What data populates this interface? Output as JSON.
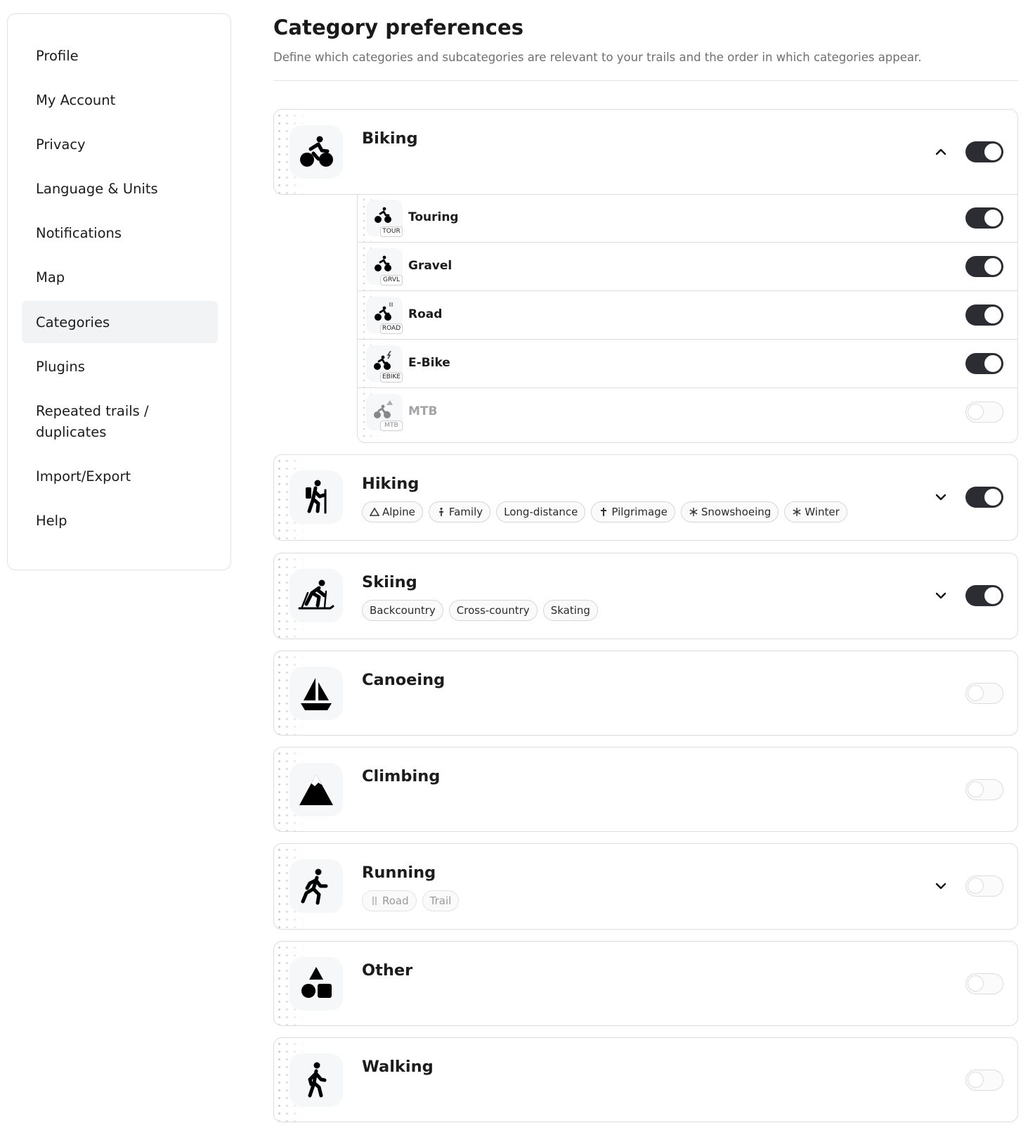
{
  "sidebar": {
    "items": [
      {
        "label": "Profile"
      },
      {
        "label": "My Account"
      },
      {
        "label": "Privacy"
      },
      {
        "label": "Language & Units"
      },
      {
        "label": "Notifications"
      },
      {
        "label": "Map"
      },
      {
        "label": "Categories",
        "active": true
      },
      {
        "label": "Plugins"
      },
      {
        "label": "Repeated trails / duplicates"
      },
      {
        "label": "Import/Export"
      },
      {
        "label": "Help"
      }
    ]
  },
  "header": {
    "title": "Category preferences",
    "subtitle": "Define which categories and subcategories are relevant to your trails and the order in which categories appear."
  },
  "categories": [
    {
      "name": "Biking",
      "icon": "bike-icon",
      "enabled": true,
      "expanded": true,
      "subcategories": [
        {
          "name": "Touring",
          "badge": "TOUR",
          "enabled": true
        },
        {
          "name": "Gravel",
          "badge": "GRVL",
          "enabled": true
        },
        {
          "name": "Road",
          "badge": "ROAD",
          "enabled": true
        },
        {
          "name": "E-Bike",
          "badge": "EBIKE",
          "enabled": true
        },
        {
          "name": "MTB",
          "badge": "MTB",
          "enabled": false
        }
      ]
    },
    {
      "name": "Hiking",
      "icon": "hiker-icon",
      "enabled": true,
      "expanded": false,
      "chips": [
        {
          "label": "Alpine",
          "icon": "mountain-icon"
        },
        {
          "label": "Family",
          "icon": "person-icon"
        },
        {
          "label": "Long-distance",
          "icon": ""
        },
        {
          "label": "Pilgrimage",
          "icon": "cross-icon"
        },
        {
          "label": "Snowshoeing",
          "icon": "snowflake-icon"
        },
        {
          "label": "Winter",
          "icon": "snowflake-icon"
        }
      ]
    },
    {
      "name": "Skiing",
      "icon": "skier-icon",
      "enabled": true,
      "expanded": false,
      "chips": [
        {
          "label": "Backcountry",
          "icon": ""
        },
        {
          "label": "Cross-country",
          "icon": ""
        },
        {
          "label": "Skating",
          "icon": ""
        }
      ]
    },
    {
      "name": "Canoeing",
      "icon": "sailboat-icon",
      "enabled": false
    },
    {
      "name": "Climbing",
      "icon": "mountain-icon",
      "enabled": false
    },
    {
      "name": "Running",
      "icon": "runner-icon",
      "enabled": false,
      "expanded": false,
      "chips": [
        {
          "label": "Road",
          "icon": "road-icon"
        },
        {
          "label": "Trail",
          "icon": ""
        }
      ]
    },
    {
      "name": "Other",
      "icon": "shapes-icon",
      "enabled": false
    },
    {
      "name": "Walking",
      "icon": "walker-icon",
      "enabled": false
    }
  ]
}
